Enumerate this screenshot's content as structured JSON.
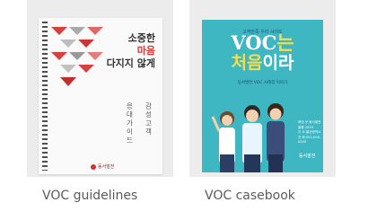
{
  "cards": [
    {
      "caption": "VOC guidelines",
      "book": {
        "title_line1": "소중한",
        "title_line2": "마음",
        "title_line3": "다지지 않게",
        "sub_col1": "응대가이드",
        "sub_col2": "감성고객",
        "logo_text": "동서발전",
        "accent_color": "#d33b3b"
      }
    },
    {
      "caption": "VOC casebook",
      "book": {
        "subtitle": "고객만족 우리 사이도",
        "title_line1_a": "VOC",
        "title_line1_b": "는",
        "title_line2_a": "처음",
        "title_line2_b": "이라",
        "author_line": "동서발전 VOC 사례집 이야기",
        "notes": [
          "펴낸 곳 동서발전",
          "발행 2019",
          "주 소 울산광역시",
          "전 화 052-000-0000"
        ],
        "logo_text": "동서발전",
        "cover_color": "#3fb7c2"
      }
    }
  ]
}
